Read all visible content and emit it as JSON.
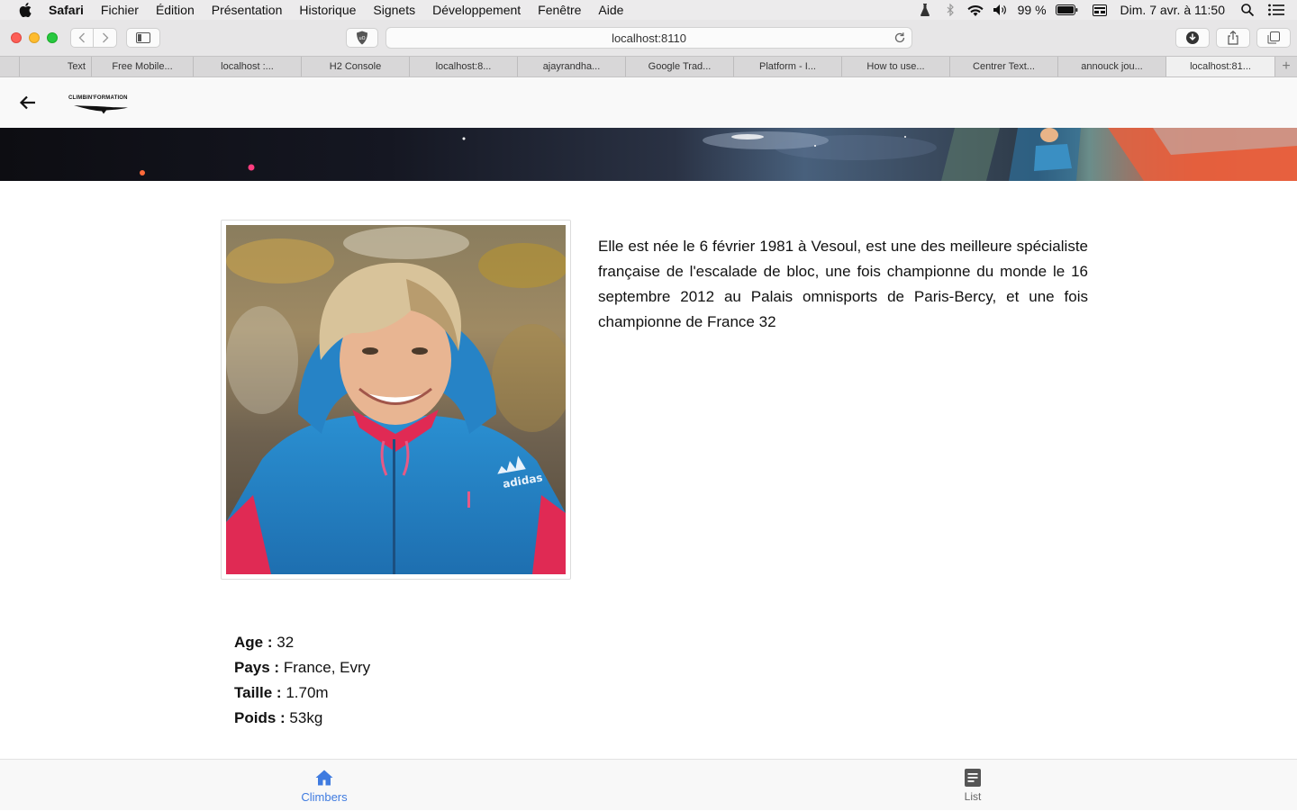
{
  "menubar": {
    "app_name": "Safari",
    "items": [
      "Fichier",
      "Édition",
      "Présentation",
      "Historique",
      "Signets",
      "Développement",
      "Fenêtre",
      "Aide"
    ],
    "battery": "99 %",
    "clock": "Dim. 7 avr. à 11:50"
  },
  "browser": {
    "url": "localhost:8110",
    "tabs": [
      "Text",
      "Free Mobile...",
      "localhost :...",
      "H2 Console",
      "localhost:8...",
      "ajayrandha...",
      "Google Trad...",
      "Platform - I...",
      "How to use...",
      "Centrer Text...",
      "annouck jou...",
      "localhost:81..."
    ],
    "new_tab": "+"
  },
  "header": {
    "logo_text": "CLIMBIN'FORMATION"
  },
  "climber": {
    "bio": "Elle est née le 6 février 1981 à Vesoul, est une des meilleure spécialiste française de l'escalade de bloc, une fois championne du monde le 16 septembre 2012 au Palais omnisports de Paris-Bercy, et une fois championne de France 32",
    "stats": [
      {
        "label": "Age :",
        "value": "32"
      },
      {
        "label": "Pays :",
        "value": "France, Evry"
      },
      {
        "label": "Taille :",
        "value": "1.70m"
      },
      {
        "label": "Poids :",
        "value": "53kg"
      }
    ],
    "jacket_brand": "adidas"
  },
  "bottom_nav": {
    "items": [
      {
        "label": "Climbers",
        "icon": "home-icon",
        "active": true
      },
      {
        "label": "List",
        "icon": "list-icon",
        "active": false
      }
    ]
  },
  "colors": {
    "accent": "#3f7be0",
    "nav_inactive": "#666666"
  }
}
